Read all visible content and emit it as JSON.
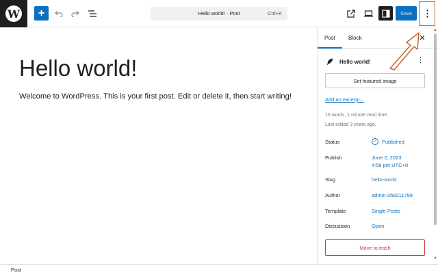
{
  "toolbar": {
    "logo_glyph": "W",
    "add_symbol": "+",
    "command_title": "Hello world! · Post",
    "command_shortcut": "Ctrl+K",
    "save_label": "Save",
    "icons": [
      "wordpress-logo-icon",
      "undo-icon",
      "redo-icon",
      "list-view-icon",
      "view-external-icon",
      "preview-device-icon",
      "settings-panel-icon",
      "options-icon"
    ],
    "accent": "#0a72c0"
  },
  "editor": {
    "title": "Hello world!",
    "body": "Welcome to WordPress. This is your first post. Edit or delete it, then start writing!"
  },
  "sidebar": {
    "tabs": [
      {
        "label": "Post",
        "active": true
      },
      {
        "label": "Block",
        "active": false
      }
    ],
    "close_symbol": "✕",
    "post_title": "Hello world!",
    "featured_image_label": "Set featured image",
    "excerpt_label": "Add an excerpt...",
    "meta_words": "15 words, 1 minute read time.",
    "meta_edited": "Last edited 3 years ago.",
    "rows": [
      {
        "label": "Status",
        "value": "Published"
      },
      {
        "label": "Publish",
        "value": "June 2, 2023",
        "value2": "4:58 pm UTC+0"
      },
      {
        "label": "Slug",
        "value": "hello-world"
      },
      {
        "label": "Author",
        "value": "admin-358211799"
      },
      {
        "label": "Template",
        "value": "Single Posts"
      },
      {
        "label": "Discussion",
        "value": "Open"
      }
    ],
    "trash_label": "Move to trash",
    "danger_color": "#cc3a3a"
  },
  "footer": {
    "breadcrumb": "Post"
  },
  "annotation": {
    "color": "#c8642c"
  }
}
